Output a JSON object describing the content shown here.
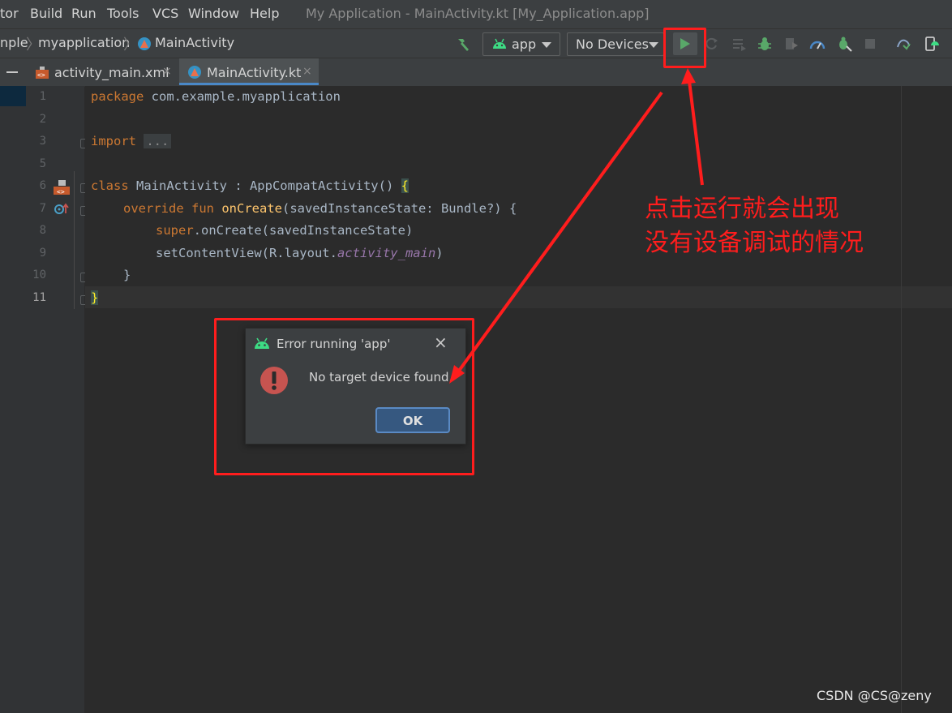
{
  "menu": {
    "items": [
      "tor",
      "Build",
      "Run",
      "Tools",
      "VCS",
      "Window",
      "Help"
    ],
    "window_title": "My Application - MainActivity.kt [My_Application.app]"
  },
  "navbar": {
    "breadcrumbs": [
      "nple",
      "myapplication",
      "MainActivity"
    ],
    "config_dropdown": "app",
    "device_dropdown": "No Devices",
    "toolbar_icons": [
      "hammer-icon",
      "android-icon",
      "run-icon",
      "rerun-icon",
      "apply-changes-icon",
      "debug-icon",
      "coverage-icon",
      "profiler-icon",
      "attach-debugger-icon",
      "stop-icon",
      "sync-gradle-icon",
      "device-manager-icon"
    ]
  },
  "tabs": [
    {
      "label": "activity_main.xml",
      "close": "×"
    },
    {
      "label": "MainActivity.kt",
      "close": "×"
    }
  ],
  "editor": {
    "line_numbers": [
      "1",
      "2",
      "3",
      "5",
      "6",
      "7",
      "8",
      "9",
      "10",
      "11"
    ],
    "line1": {
      "kw": "package",
      "rest": " com.example.myapplication"
    },
    "line3": {
      "kw": "import",
      "placeholder": "..."
    },
    "line6": {
      "kw": "class",
      "rest": " MainActivity : AppCompatActivity() ",
      "brace": "{"
    },
    "line7": {
      "kw": "override fun",
      "fn": "onCreate",
      "rest": "(savedInstanceState: Bundle?) {"
    },
    "line8": {
      "kw": "super",
      "rest": ".onCreate(savedInstanceState)"
    },
    "line9": {
      "pre": "setContentView(R.layout.",
      "it": "activity_main",
      "post": ")"
    },
    "line10": {
      "rest": "}"
    },
    "line11": {
      "brace": "}"
    }
  },
  "dialog": {
    "title": "Error running 'app'",
    "close": "×",
    "message": "No target device found.",
    "ok_label": "OK"
  },
  "annotation": {
    "line1": "点击运行就会出现",
    "line2": "没有设备调试的情况"
  },
  "watermark": "CSDN @CS@zeny",
  "colors": {
    "annotation_red": "#ff1d1d",
    "run_green": "#59a869",
    "android_green": "#3ddc84",
    "error_red": "#c75450"
  }
}
